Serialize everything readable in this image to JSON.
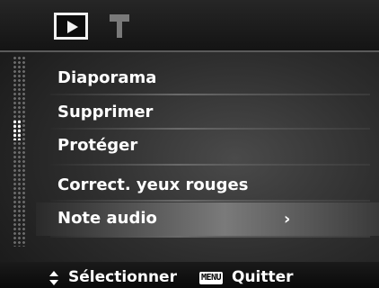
{
  "tabs": [
    {
      "icon": "play-icon",
      "selected": true
    },
    {
      "icon": "wrench-icon",
      "selected": false
    }
  ],
  "menu": {
    "items": [
      {
        "label": "Diaporama"
      },
      {
        "label": "Supprimer"
      },
      {
        "label": "Protéger"
      },
      {
        "label": "Correct. yeux rouges"
      },
      {
        "label": "Note audio",
        "selected": true,
        "submenu_indicator": "›"
      }
    ],
    "scroll_position": 0.5
  },
  "footer": {
    "navigate_icon": "up-down-arrows-icon",
    "select_label": "Sélectionner",
    "menu_key": "MENU",
    "quit_label": "Quitter"
  },
  "colors": {
    "text": "#ffffff",
    "background": "#2e2e2e",
    "highlight": "#7a7a7a"
  }
}
